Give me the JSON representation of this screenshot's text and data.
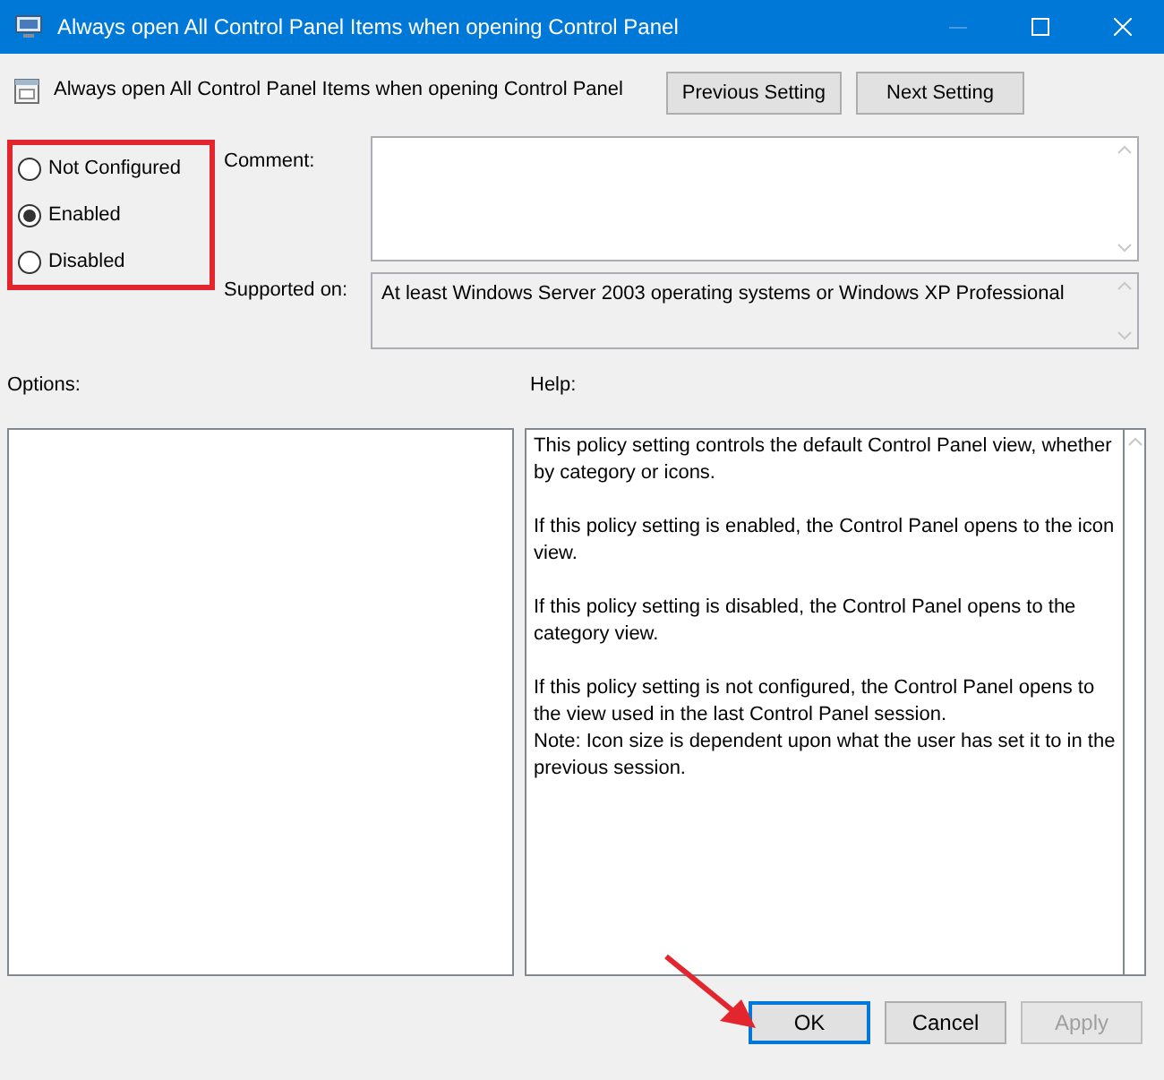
{
  "window": {
    "title": "Always open All Control Panel Items when opening Control Panel"
  },
  "header": {
    "title": "Always open All Control Panel Items when opening Control Panel",
    "buttons": [
      {
        "label": "Previous Setting"
      },
      {
        "label": "Next Setting"
      }
    ]
  },
  "policy_options": [
    {
      "label": "Not Configured",
      "selected": false
    },
    {
      "label": "Enabled",
      "selected": true
    },
    {
      "label": "Disabled",
      "selected": false
    }
  ],
  "comment": {
    "label": "Comment:"
  },
  "supported_on": {
    "label": "Supported on:",
    "value": "At least Windows Server 2003 operating systems or Windows XP Professional"
  },
  "options": {
    "label": "Options:"
  },
  "help": {
    "label": "Help:",
    "paragraphs": [
      [
        "This policy setting controls the default Control Panel view, whether by category or icons."
      ],
      [
        "If this policy setting is enabled, the Control Panel opens to the icon view."
      ],
      [
        "If this policy setting is disabled, the Control Panel opens to the category view."
      ],
      [
        "If this policy setting is not configured, the Control Panel opens to the view used in the last Control Panel session.",
        "Note: Icon size is dependent upon what the user has set it to in the previous session."
      ]
    ]
  },
  "footer_buttons": [
    {
      "label": "OK",
      "default": true,
      "disabled": false
    },
    {
      "label": "Cancel",
      "default": false,
      "disabled": false
    },
    {
      "label": "Apply",
      "default": false,
      "disabled": true
    }
  ]
}
